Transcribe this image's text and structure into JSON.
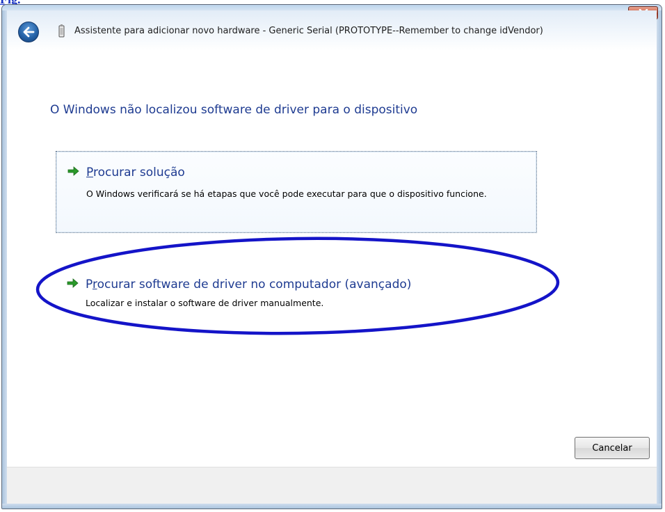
{
  "figure_label": "Fig.",
  "window": {
    "title": "Assistente para adicionar novo hardware - Generic Serial (PROTOTYPE--Remember to change idVendor)",
    "heading": "O Windows não localizou software de driver para o dispositivo"
  },
  "options": [
    {
      "title_underlined": "P",
      "title_rest": "rocurar solução",
      "description": "O Windows verificará se há etapas que você pode executar para que o dispositivo funcione."
    },
    {
      "title_first": "P",
      "title_underlined": "r",
      "title_rest": "ocurar software de driver no computador (avançado)",
      "description": "Localizar e instalar o software de driver manualmente."
    }
  ],
  "footer": {
    "cancel_label": "Cancelar"
  },
  "colors": {
    "accent_text": "#1e3b91",
    "annotation_ellipse": "#1414c8",
    "close_button": "#c8503a"
  },
  "icons": {
    "back": "back-arrow-icon",
    "device": "usb-device-icon",
    "option_arrow": "green-arrow-icon",
    "close": "close-x-icon"
  }
}
